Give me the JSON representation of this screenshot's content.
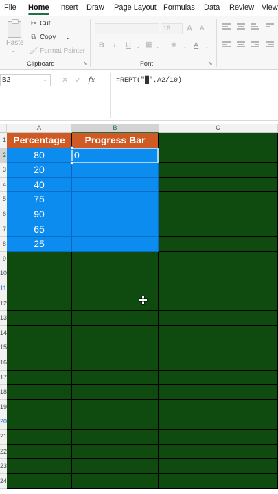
{
  "menu": {
    "tabs": [
      "File",
      "Home",
      "Insert",
      "Draw",
      "Page Layout",
      "Formulas",
      "Data",
      "Review",
      "View"
    ],
    "active": "Home"
  },
  "ribbon": {
    "clipboard": {
      "paste_label": "Paste",
      "cut_label": "Cut",
      "copy_label": "Copy",
      "format_painter_label": "Format Painter",
      "group_label": "Clipboard"
    },
    "font": {
      "size_value": "16",
      "bold": "B",
      "italic": "I",
      "underline": "U",
      "grow": "A",
      "shrink": "A",
      "font_color": "A",
      "group_label": "Font"
    }
  },
  "formula_bar": {
    "name_box": "B2",
    "formula": "=REPT(\"█\",A2/10)"
  },
  "sheet": {
    "columns": [
      "A",
      "B",
      "C"
    ],
    "row_numbers": [
      "1",
      "2",
      "3",
      "4",
      "5",
      "6",
      "7",
      "8",
      "9",
      "10",
      "11",
      "12",
      "13",
      "14",
      "15",
      "16",
      "17",
      "18",
      "19",
      "20",
      "21",
      "22",
      "23",
      "24"
    ],
    "header": {
      "percentage": "Percentage",
      "progress_bar": "Progress Bar"
    },
    "percentages": [
      "80",
      "20",
      "40",
      "75",
      "90",
      "65",
      "25"
    ],
    "active_cell_value": "0",
    "colors": {
      "header_fill": "#cf5a24",
      "data_fill": "#0d8cf0",
      "background_fill": "#0f4b0f",
      "excel_green": "#1e7145"
    }
  }
}
